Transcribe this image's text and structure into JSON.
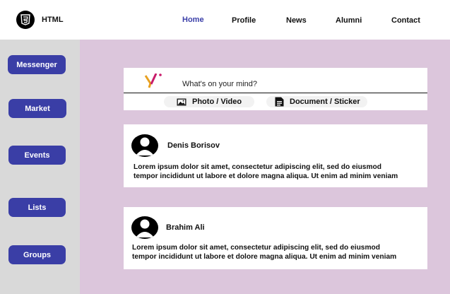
{
  "header": {
    "brand": "HTML",
    "nav": [
      "Home",
      "Profile",
      "News",
      "Alumni",
      "Contact"
    ],
    "active_nav": "Home"
  },
  "sidebar": {
    "items": [
      {
        "label": "Messenger"
      },
      {
        "label": "Market"
      },
      {
        "label": "Events"
      },
      {
        "label": "Lists"
      },
      {
        "label": "Groups"
      }
    ]
  },
  "composer": {
    "placeholder": "What's on your mind?",
    "photo_label": "Photo / Video",
    "document_label": "Document / Sticker"
  },
  "posts": [
    {
      "author": "Denis Borisov",
      "text_line1": "Lorem ipsum dolor sit amet, consectetur adipiscing elit, sed do eiusmod",
      "text_line2": "tempor incididunt ut labore et dolore magna aliqua. Ut enim ad minim veniam"
    },
    {
      "author": "Brahim Ali",
      "text_line1": "Lorem ipsum dolor sit amet, consectetur adipiscing elit, sed do eiusmod",
      "text_line2": "tempor incididunt ut labore et dolore magna aliqua. Ut enim ad minim veniam"
    }
  ],
  "colors": {
    "accent": "#3a3ea6",
    "sidebar_bg": "#d9d9d9",
    "main_bg": "#dcc6dc",
    "card_bg": "#ffffff"
  },
  "icons": {
    "logo": "html5-icon",
    "photo": "image-icon",
    "document": "document-icon",
    "avatar": "user-avatar-icon"
  }
}
